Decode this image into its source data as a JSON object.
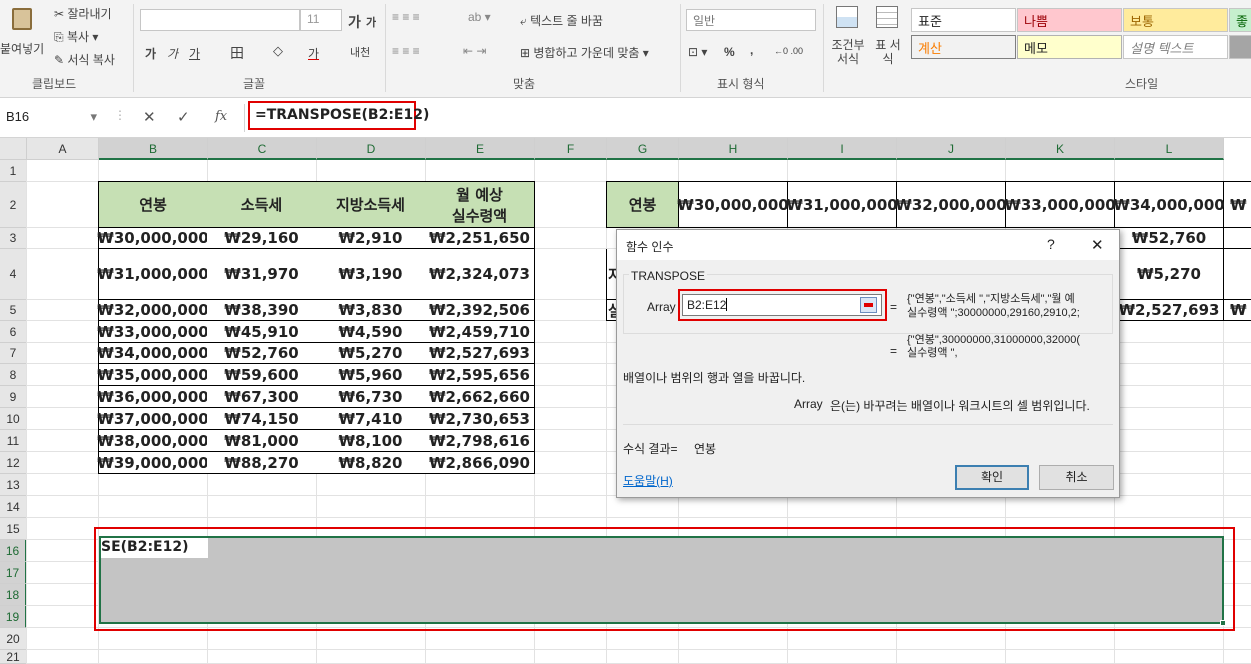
{
  "ribbon": {
    "clipboard": {
      "paste": "붙여넣기",
      "cut": "잘라내기",
      "copy": "복사",
      "format_painter": "서식 복사",
      "group": "클립보드"
    },
    "font": {
      "size": "11",
      "grow": "가",
      "shrink": "가",
      "bold": "가",
      "italic": "가",
      "underline": "가",
      "border": "田",
      "fill": "◇",
      "font_color": "가",
      "phonetic": "내천",
      "group": "글꼴"
    },
    "alignment": {
      "wrap": "텍스트 줄 바꿈",
      "merge": "병합하고 가운데 맞춤",
      "group": "맞춤"
    },
    "number": {
      "format": "일반",
      "percent": "%",
      "comma": ",",
      "inc": "←0 .00",
      "dec": ".00 →0",
      "group": "표시 형식"
    },
    "styles": {
      "cond": "조건부 서식",
      "table": "표 서식",
      "normal": "표준",
      "bad": "나쁨",
      "neutral": "보통",
      "good": "좋",
      "calc": "계산",
      "memo": "메모",
      "explain": "설명 텍스트",
      "group": "스타일"
    }
  },
  "formula_bar": {
    "name_box": "B16",
    "cancel": "✕",
    "enter": "✓",
    "fx": "fx",
    "formula": "=TRANSPOSE(B2:E12)"
  },
  "columns": [
    "A",
    "B",
    "C",
    "D",
    "E",
    "F",
    "G",
    "H",
    "I",
    "J",
    "K",
    "L"
  ],
  "rows": [
    "1",
    "2",
    "3",
    "4",
    "5",
    "6",
    "7",
    "8",
    "9",
    "10",
    "11",
    "12",
    "13",
    "14",
    "15",
    "16",
    "17",
    "18",
    "19",
    "20",
    "21"
  ],
  "table": {
    "headers": [
      "연봉",
      "소득세",
      "지방소득세",
      "월 예상\n실수령액"
    ],
    "rows": [
      [
        "₩30,000,000",
        "₩29,160",
        "₩2,910",
        "₩2,251,650"
      ],
      [
        "₩31,000,000",
        "₩31,970",
        "₩3,190",
        "₩2,324,073"
      ],
      [
        "₩32,000,000",
        "₩38,390",
        "₩3,830",
        "₩2,392,506"
      ],
      [
        "₩33,000,000",
        "₩45,910",
        "₩4,590",
        "₩2,459,710"
      ],
      [
        "₩34,000,000",
        "₩52,760",
        "₩5,270",
        "₩2,527,693"
      ],
      [
        "₩35,000,000",
        "₩59,600",
        "₩5,960",
        "₩2,595,656"
      ],
      [
        "₩36,000,000",
        "₩67,300",
        "₩6,730",
        "₩2,662,660"
      ],
      [
        "₩37,000,000",
        "₩74,150",
        "₩7,410",
        "₩2,730,653"
      ],
      [
        "₩38,000,000",
        "₩81,000",
        "₩8,100",
        "₩2,798,616"
      ],
      [
        "₩39,000,000",
        "₩88,270",
        "₩8,820",
        "₩2,866,090"
      ]
    ]
  },
  "transposed": {
    "header": "연봉",
    "row2": [
      "₩30,000,000",
      "₩31,000,000",
      "₩32,000,000",
      "₩33,000,000",
      "₩34,000,000",
      "₩"
    ],
    "row3_l": "₩52,760",
    "row4_l": "₩5,270",
    "row5_l": "₩2,527,693",
    "row5_m": "₩",
    "row4_g": "지",
    "row5_g": "실"
  },
  "editing_cell": "SE(B2:E12)",
  "dialog": {
    "title": "함수 인수",
    "help": "?",
    "close": "✕",
    "function": "TRANSPOSE",
    "arg_label": "Array",
    "arg_value": "B2:E12",
    "eq1": "=",
    "arg_result_1": "{\"연봉\",\"소득세 \",\"지방소득세\",\"월 예",
    "arg_result_2": "실수령액 \";30000000,29160,2910,2;",
    "eq2": "=",
    "result_1": "{\"연봉\",30000000,31000000,32000(",
    "result_2": "실수령액 \",",
    "description": "배열이나 범위의 행과 열을 바꿉니다.",
    "arg_desc_name": "Array",
    "arg_desc": "은(는) 바꾸려는 배열이나 워크시트의 셀 범위입니다.",
    "formula_result_label": "수식 결과=",
    "formula_result": "연봉",
    "help_link": "도움말(H)",
    "ok": "확인",
    "cancel": "취소"
  }
}
